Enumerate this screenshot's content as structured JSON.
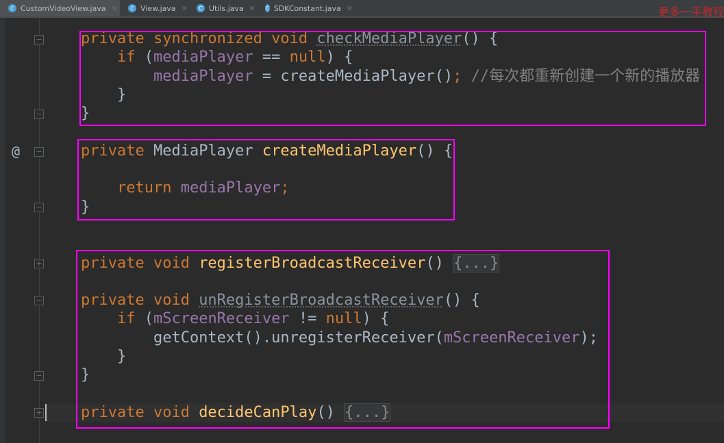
{
  "tabs": [
    {
      "label": "CustomVideoView.java",
      "active": true
    },
    {
      "label": "View.java",
      "active": false
    },
    {
      "label": "Utils.java",
      "active": false
    },
    {
      "label": "SDKConstant.java",
      "active": false
    }
  ],
  "watermark": "更多一手教程",
  "gutter": {
    "override_marker": "@"
  },
  "code_lines": [
    [
      [
        "private synchronized void ",
        "kw"
      ],
      [
        "checkMediaPlayer",
        "un"
      ],
      [
        "() {",
        "pl"
      ]
    ],
    [
      [
        "    if ",
        "kw"
      ],
      [
        "(",
        "pl"
      ],
      [
        "mediaPlayer",
        "fd"
      ],
      [
        " == ",
        "pl"
      ],
      [
        "null",
        "kw"
      ],
      [
        ") {",
        "pl"
      ]
    ],
    [
      [
        "        ",
        "pl"
      ],
      [
        "mediaPlayer",
        "fd"
      ],
      [
        " = createMediaPlayer()",
        "pl"
      ],
      [
        ";",
        "kw"
      ],
      [
        " //每次都重新创建一个新的播放器",
        "cm"
      ]
    ],
    [
      [
        "    }",
        "pl"
      ]
    ],
    [
      [
        "}",
        "pl"
      ]
    ],
    [],
    [
      [
        "private ",
        "kw"
      ],
      [
        "MediaPlayer ",
        "pl"
      ],
      [
        "createMediaPlayer",
        "mn"
      ],
      [
        "() {",
        "pl"
      ]
    ],
    [],
    [
      [
        "    return ",
        "kw"
      ],
      [
        "mediaPlayer",
        "fd"
      ],
      [
        ";",
        "kw"
      ]
    ],
    [
      [
        "}",
        "pl"
      ]
    ],
    [],
    [],
    [
      [
        "private void ",
        "kw"
      ],
      [
        "registerBroadcastReceiver",
        "mn"
      ],
      [
        "() ",
        "pl"
      ],
      [
        "{...}",
        "fo"
      ]
    ],
    [],
    [
      [
        "private void ",
        "kw"
      ],
      [
        "unRegisterBroadcastReceiver",
        "un"
      ],
      [
        "() {",
        "pl"
      ]
    ],
    [
      [
        "    if ",
        "kw"
      ],
      [
        "(",
        "pl"
      ],
      [
        "mScreenReceiver",
        "fd"
      ],
      [
        " != ",
        "pl"
      ],
      [
        "null",
        "kw"
      ],
      [
        ") {",
        "pl"
      ]
    ],
    [
      [
        "        getContext().unregisterReceiver(",
        "pl"
      ],
      [
        "mScreenReceiver",
        "fd"
      ],
      [
        ");",
        "pl"
      ]
    ],
    [
      [
        "    }",
        "pl"
      ]
    ],
    [
      [
        "}",
        "pl"
      ]
    ],
    [],
    [
      [
        "private void ",
        "kw"
      ],
      [
        "decideCanPlay",
        "mn"
      ],
      [
        "() ",
        "pl"
      ],
      [
        "{...}",
        "fo"
      ]
    ]
  ],
  "highlight_color": "#ff00ff"
}
